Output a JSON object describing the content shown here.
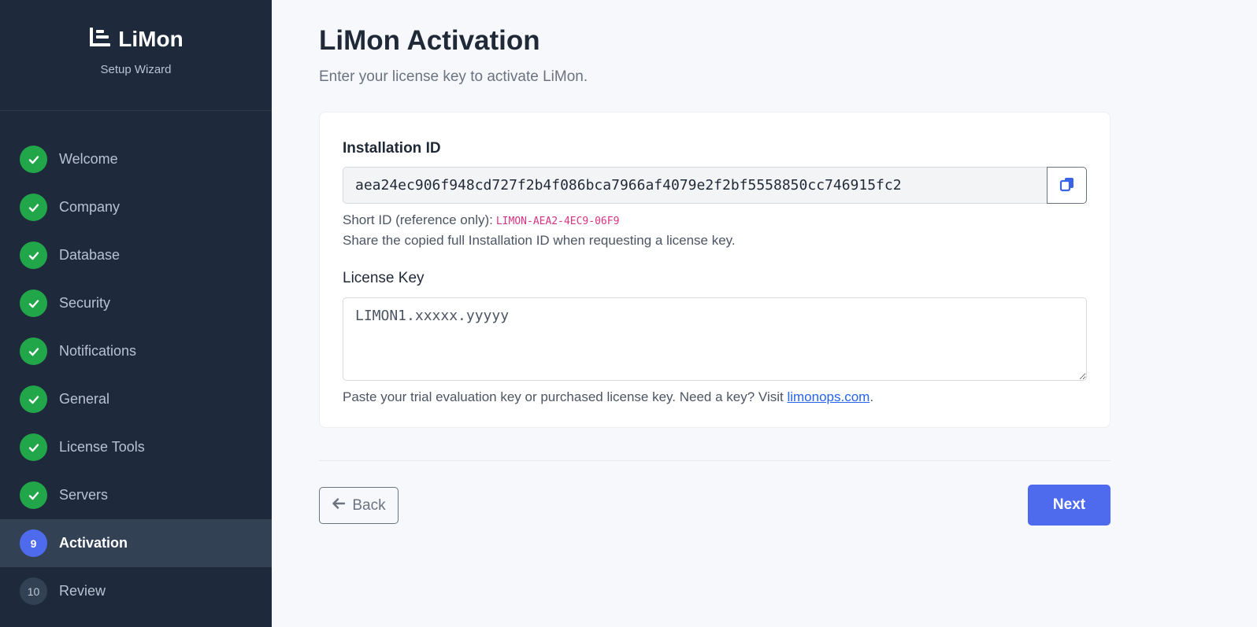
{
  "sidebar": {
    "brand": "LiMon",
    "subtitle": "Setup Wizard",
    "steps": [
      {
        "label": "Welcome",
        "state": "done"
      },
      {
        "label": "Company",
        "state": "done"
      },
      {
        "label": "Database",
        "state": "done"
      },
      {
        "label": "Security",
        "state": "done"
      },
      {
        "label": "Notifications",
        "state": "done"
      },
      {
        "label": "General",
        "state": "done"
      },
      {
        "label": "License Tools",
        "state": "done"
      },
      {
        "label": "Servers",
        "state": "done"
      },
      {
        "label": "Activation",
        "state": "current",
        "number": "9"
      },
      {
        "label": "Review",
        "state": "todo",
        "number": "10"
      }
    ]
  },
  "main": {
    "title": "LiMon Activation",
    "subtitle": "Enter your license key to activate LiMon.",
    "installation": {
      "label": "Installation ID",
      "value": "aea24ec906f948cd727f2b4f086bca7966af4079e2f2bf5558850cc746915fc2",
      "short_prefix": "Short ID (reference only):",
      "short_id": "LIMON-AEA2-4EC9-06F9",
      "share_hint": "Share the copied full Installation ID when requesting a license key."
    },
    "license": {
      "label": "License Key",
      "placeholder": "LIMON1.xxxxx.yyyyy",
      "value": "",
      "hint_prefix": "Paste your trial evaluation key or purchased license key. Need a key? Visit ",
      "link_text": "limonops.com",
      "hint_suffix": "."
    },
    "back_label": "Back",
    "next_label": "Next"
  },
  "colors": {
    "sidebar_bg": "#1e293b",
    "active_step_bg": "#334155",
    "done_green": "#22a64a",
    "accent_blue": "#4f6bed",
    "short_id_pink": "#d63384",
    "link_blue": "#2563eb"
  }
}
